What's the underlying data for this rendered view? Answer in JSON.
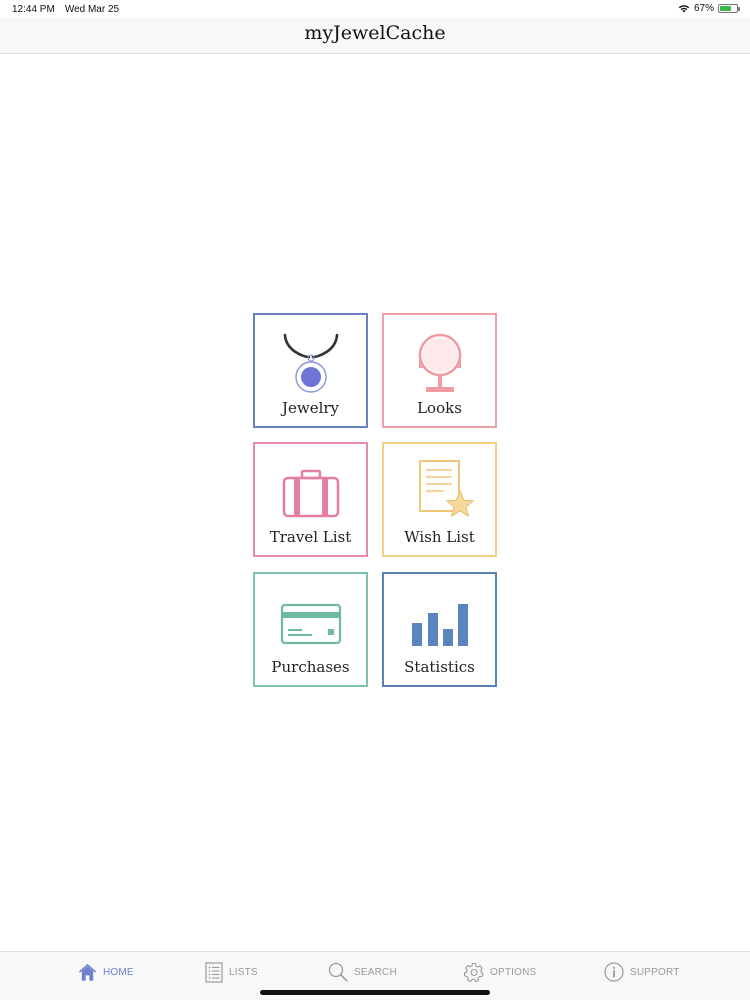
{
  "status_bar": {
    "time": "12:44 PM",
    "date": "Wed Mar 25",
    "battery_percent": "67%",
    "battery_level": 0.67
  },
  "nav": {
    "title": "myJewelCache"
  },
  "tiles": [
    {
      "label": "Jewelry",
      "icon": "necklace-icon",
      "color": "#6b80c0"
    },
    {
      "label": "Looks",
      "icon": "mirror-icon",
      "color": "#f0a0a8"
    },
    {
      "label": "Travel List",
      "icon": "suitcase-icon",
      "color": "#e48aac"
    },
    {
      "label": "Wish List",
      "icon": "wish-star-icon",
      "color": "#f2cf84"
    },
    {
      "label": "Purchases",
      "icon": "credit-card-icon",
      "color": "#7cc2a8"
    },
    {
      "label": "Statistics",
      "icon": "bar-chart-icon",
      "color": "#5a82b0"
    }
  ],
  "tab_bar": {
    "active_color": "#6f7fcc",
    "inactive_color": "#9a9a9a",
    "items": [
      {
        "label": "HOME",
        "icon": "home-icon",
        "active": true
      },
      {
        "label": "LISTS",
        "icon": "list-icon",
        "active": false
      },
      {
        "label": "SEARCH",
        "icon": "search-icon",
        "active": false
      },
      {
        "label": "OPTIONS",
        "icon": "gear-icon",
        "active": false
      },
      {
        "label": "SUPPORT",
        "icon": "info-icon",
        "active": false
      }
    ]
  }
}
